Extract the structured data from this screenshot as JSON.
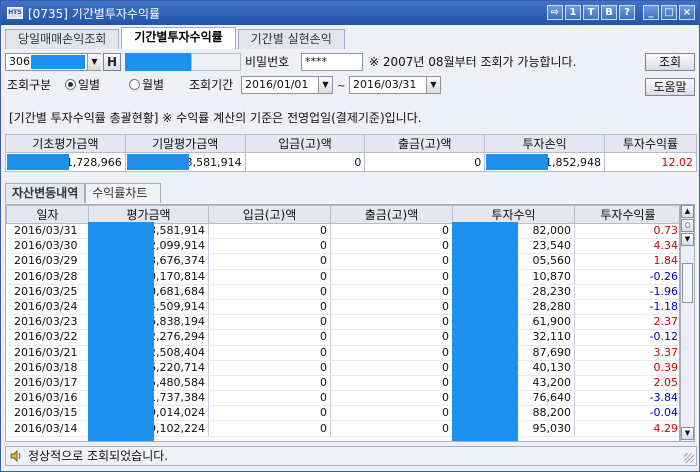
{
  "window": {
    "title": "[0735] 기간별투자수익률",
    "icon": "app-icon",
    "buttons": [
      "export-icon",
      "info-icon",
      "T",
      "B",
      "?",
      "minimize",
      "restore",
      "close"
    ]
  },
  "tabs": [
    "당일매매손익조회",
    "기간별투자수익률",
    "기간별 실현손익"
  ],
  "account": {
    "prefix": "306",
    "h_button": "H",
    "password_label": "비밀번호",
    "password_value": "****",
    "notice": "※ 2007년  08월부터 조회가 가능합니다.",
    "query_button": "조회",
    "help_button": "도움말"
  },
  "filter": {
    "type_label": "조회구분",
    "daily": "일별",
    "monthly": "월별",
    "period_label": "조회기간",
    "start": "2016/01/01",
    "tilde": "~",
    "end": "2016/03/31"
  },
  "summary_note": "[기간별 투자수익률 총괄현황] ※ 수익률 계산의 기준은 전영업일(결제기준)입니다.",
  "summary": {
    "headers": [
      "기초평가금액",
      "기말평가금액",
      "입금(고)액",
      "출금(고)액",
      "투자손익",
      "투자수익률"
    ],
    "values": [
      "1,728,966",
      "3,581,914",
      "0",
      "0",
      "1,852,948",
      "12.02"
    ]
  },
  "subtabs": [
    "자산변동내역",
    "수익률차트"
  ],
  "grid": {
    "headers": [
      "일자",
      "평가금액",
      "입금(고)액",
      "출금(고)액",
      "투자수익",
      "투자수익률"
    ],
    "rows": [
      [
        "2016/03/31",
        "3,581,914",
        "0",
        "0",
        "82,000",
        "0.73",
        "red"
      ],
      [
        "2016/03/30",
        "2,099,914",
        "0",
        "0",
        "23,540",
        "4.34",
        "red"
      ],
      [
        "2016/03/29",
        "3,676,374",
        "0",
        "0",
        "05,560",
        "1.84",
        "red"
      ],
      [
        "2016/03/28",
        "0,170,814",
        "0",
        "0",
        "10,870",
        "-0.26",
        "bl"
      ],
      [
        "2016/03/25",
        "0,681,684",
        "0",
        "0",
        "28,230",
        "-1.96",
        "bl"
      ],
      [
        "2016/03/24",
        "4,509,914",
        "0",
        "0",
        "28,280",
        "-1.18",
        "bl"
      ],
      [
        "2016/03/23",
        "6,838,194",
        "0",
        "0",
        "61,900",
        "2.37",
        "red"
      ],
      [
        "2016/03/22",
        "2,276,294",
        "0",
        "0",
        "32,110",
        "-0.12",
        "bl"
      ],
      [
        "2016/03/21",
        "2,508,404",
        "0",
        "0",
        "87,690",
        "3.37",
        "red"
      ],
      [
        "2016/03/18",
        "6,220,714",
        "0",
        "0",
        "40,130",
        "0.39",
        "red"
      ],
      [
        "2016/03/17",
        "5,480,584",
        "0",
        "0",
        "43,200",
        "2.05",
        "red"
      ],
      [
        "2016/03/16",
        "1,737,384",
        "0",
        "0",
        "76,640",
        "-3.84",
        "bl"
      ],
      [
        "2016/03/15",
        "9,014,024",
        "0",
        "0",
        "88,200",
        "-0.04",
        "bl"
      ],
      [
        "2016/03/14",
        "9,102,224",
        "0",
        "0",
        "95,030",
        "4.29",
        "red"
      ]
    ]
  },
  "status": "정상적으로 조회되었습니다.",
  "colors": {
    "mask": "#1e90f0",
    "positive": "#d40000",
    "negative": "#0000c8"
  }
}
